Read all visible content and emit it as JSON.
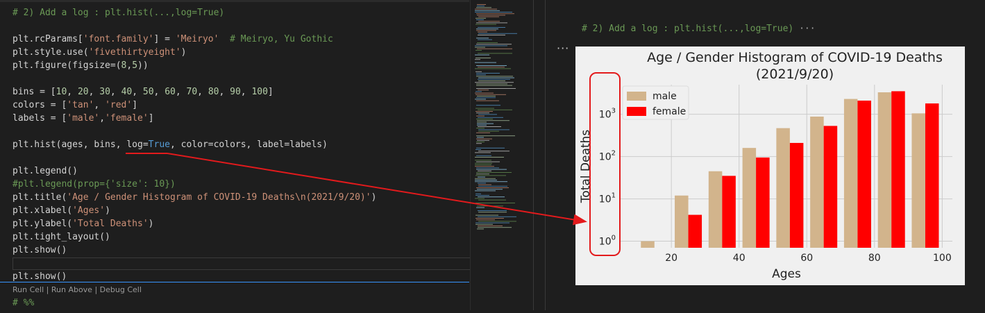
{
  "editor": {
    "lines": [
      {
        "top": 10,
        "html": "<span class='cm'># 2) Add a log : plt.hist(...,log=True)</span>"
      },
      {
        "top": 48,
        "html": "plt.rcParams[<span class='st'>'font.family'</span>] = <span class='st'>'Meiryo'</span>  <span class='cm'># Meiryo, Yu Gothic</span>"
      },
      {
        "top": 67,
        "html": "plt.style.use(<span class='st'>'fivethirtyeight'</span>)"
      },
      {
        "top": 86,
        "html": "plt.figure(figsize=(<span class='nu'>8</span>,<span class='nu'>5</span>))"
      },
      {
        "top": 124,
        "html": "bins = [<span class='nu'>10</span>, <span class='nu'>20</span>, <span class='nu'>30</span>, <span class='nu'>40</span>, <span class='nu'>50</span>, <span class='nu'>60</span>, <span class='nu'>70</span>, <span class='nu'>80</span>, <span class='nu'>90</span>, <span class='nu'>100</span>]"
      },
      {
        "top": 143,
        "html": "colors = [<span class='st'>'tan'</span>, <span class='st'>'red'</span>]"
      },
      {
        "top": 162,
        "html": "labels = [<span class='st'>'male'</span>,<span class='st'>'female'</span>]"
      },
      {
        "top": 200,
        "html": "plt.hist(ages, bins, log=<span class='kw'>True</span>, color=colors, label=labels)"
      },
      {
        "top": 238,
        "html": "plt.legend()"
      },
      {
        "top": 257,
        "html": "<span class='cm'>#plt.legend(prop={'size': 10})</span>"
      },
      {
        "top": 276,
        "html": "plt.title(<span class='st'>'Age / Gender Histogram of COVID-19 Deaths\\n(2021/9/20)'</span>)"
      },
      {
        "top": 295,
        "html": "plt.xlabel(<span class='st'>'Ages'</span>)"
      },
      {
        "top": 314,
        "html": "plt.ylabel(<span class='st'>'Total Deaths'</span>)"
      },
      {
        "top": 333,
        "html": "plt.tight_layout()"
      },
      {
        "top": 352,
        "html": "plt.show()"
      },
      {
        "top": 390,
        "html": "plt.show()"
      },
      {
        "top": 428,
        "html": "<span class='cm'># %%</span>"
      }
    ],
    "codelens": "Run Cell | Run Above | Debug Cell"
  },
  "output": {
    "header": "# 2) Add a log : plt.hist(...,log=True)",
    "header_ellipsis": "···",
    "more": "···"
  },
  "chart_data": {
    "type": "bar",
    "title": "Age / Gender Histogram of COVID-19 Deaths\n(2021/9/20)",
    "title_lines": [
      "Age / Gender Histogram of COVID-19 Deaths",
      "(2021/9/20)"
    ],
    "xlabel": "Ages",
    "ylabel": "Total Deaths",
    "log_y": true,
    "bins": [
      10,
      20,
      30,
      40,
      50,
      60,
      70,
      80,
      90,
      100
    ],
    "xlim": [
      5,
      103
    ],
    "ylim": [
      0.7,
      5000
    ],
    "xticks": [
      20,
      40,
      60,
      80,
      100
    ],
    "yticks": [
      {
        "value": 1,
        "base": "10",
        "exp": "0"
      },
      {
        "value": 10,
        "base": "10",
        "exp": "1"
      },
      {
        "value": 100,
        "base": "10",
        "exp": "2"
      },
      {
        "value": 1000,
        "base": "10",
        "exp": "3"
      }
    ],
    "grid": true,
    "legend_position": "upper-left",
    "series": [
      {
        "name": "male",
        "color": "#d2b48c",
        "values": [
          1,
          12,
          45,
          160,
          470,
          880,
          2300,
          3300,
          1050
        ]
      },
      {
        "name": "female",
        "color": "#ff0000",
        "values": [
          0,
          4.2,
          35,
          95,
          210,
          530,
          2100,
          3500,
          1800
        ]
      }
    ]
  },
  "annotation_color": "#e31a1c"
}
